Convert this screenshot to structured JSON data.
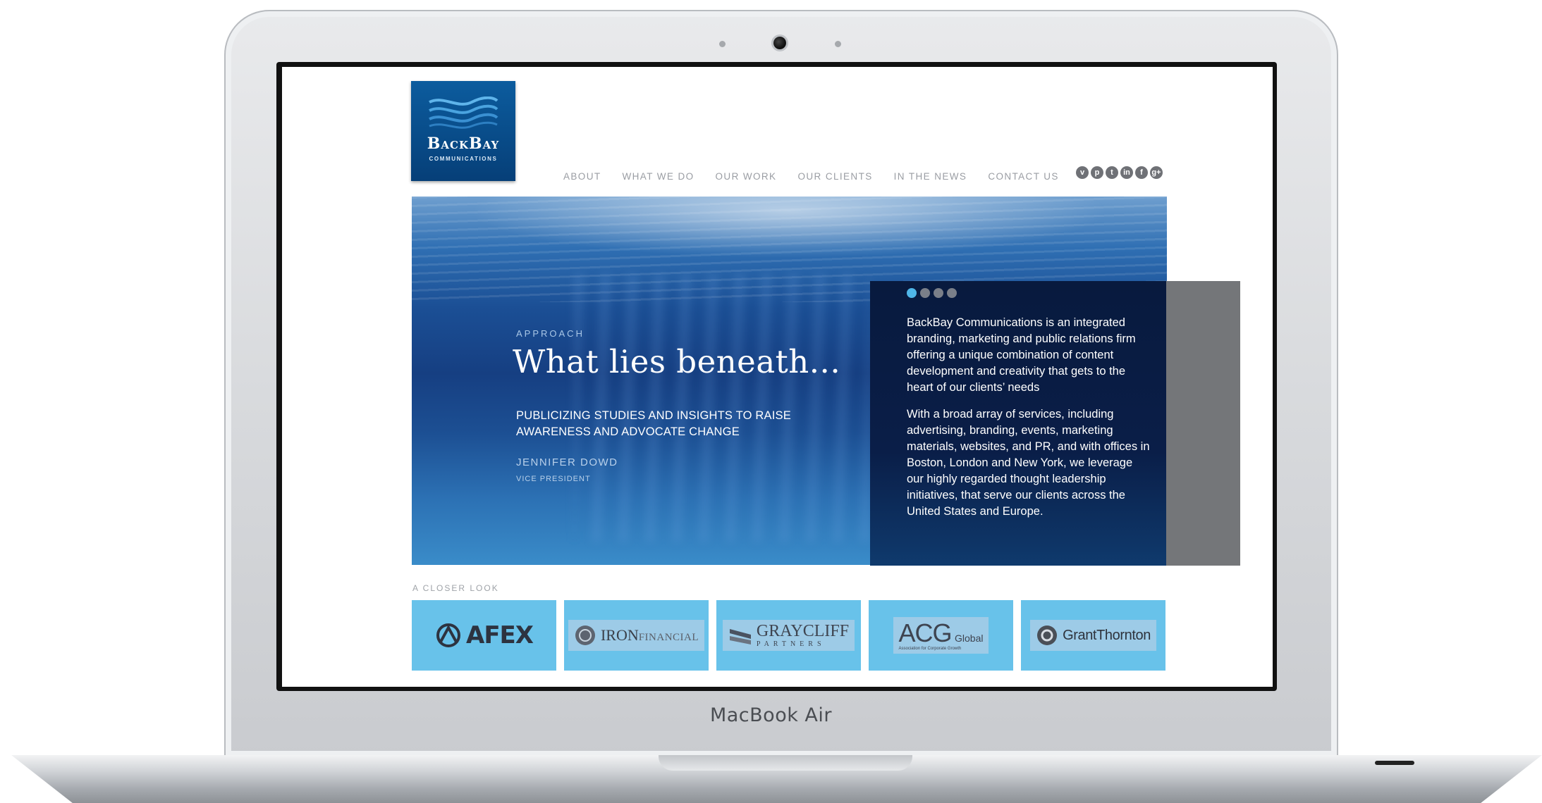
{
  "device": {
    "brand_label": "MacBook Air"
  },
  "site": {
    "logo": {
      "name": "BackBay",
      "sub": "COMMUNICATIONS"
    },
    "nav": [
      "ABOUT",
      "WHAT WE DO",
      "OUR WORK",
      "OUR CLIENTS",
      "IN THE NEWS",
      "CONTACT US"
    ],
    "social": [
      {
        "icon": "vimeo-icon",
        "glyph": "v"
      },
      {
        "icon": "pinterest-icon",
        "glyph": "p"
      },
      {
        "icon": "twitter-icon",
        "glyph": "t"
      },
      {
        "icon": "linkedin-icon",
        "glyph": "in"
      },
      {
        "icon": "facebook-icon",
        "glyph": "f"
      },
      {
        "icon": "googleplus-icon",
        "glyph": "g+"
      }
    ],
    "hero": {
      "kicker": "APPROACH",
      "title": "What lies beneath...",
      "subtitle": "PUBLICIZING STUDIES AND INSIGHTS TO RAISE AWARENESS AND ADVOCATE CHANGE",
      "person": "JENNIFER DOWD",
      "role": "VICE PRESIDENT",
      "slides": 4,
      "active_slide": 1,
      "panel_paragraphs": [
        "BackBay Communications is an integrated branding, marketing and public relations firm offering a unique combination of content development and creativity that gets to the heart of our clients’ needs",
        "With a broad array of services, including advertising, branding, events, marketing materials, websites, and PR, and with offices in Boston, London and New York, we leverage our highly regarded thought leadership initiatives, that serve our clients across the United States and Europe."
      ]
    },
    "closer_look": {
      "label": "A CLOSER LOOK",
      "clients": [
        {
          "name": "AFEX"
        },
        {
          "name": "IRON",
          "suffix": "FINANCIAL"
        },
        {
          "name": "GRAYCLIFF",
          "sub": "PARTNERS"
        },
        {
          "name": "ACG",
          "suffix": "Global",
          "tagline": "Association for Corporate Growth"
        },
        {
          "name": "GrantThornton"
        }
      ]
    }
  },
  "colors": {
    "logo_blue": "#0a4f8c",
    "tile_blue": "#68c2ea",
    "active_dot": "#4fb6e8",
    "panel_navy": "#0a1e48"
  }
}
